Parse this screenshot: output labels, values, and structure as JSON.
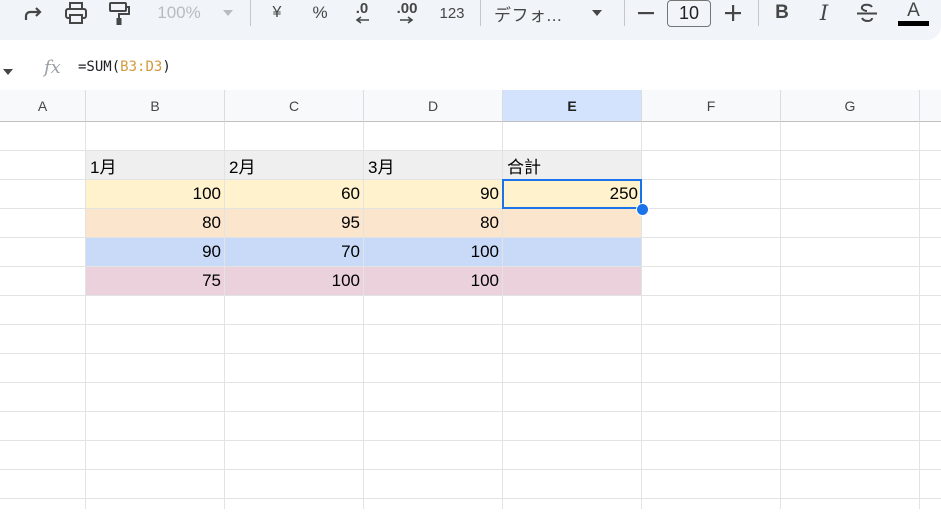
{
  "toolbar": {
    "zoom": "100%",
    "currency": "¥",
    "percent": "%",
    "decrease_decimal": ".0",
    "increase_decimal": ".00",
    "number_format": "123",
    "font_name": "デフォ...",
    "font_size": "10",
    "bold": "B",
    "italic": "I",
    "text_color_glyph": "A"
  },
  "formula_bar": {
    "fx": "fx",
    "prefix": "=SUM(",
    "ref": "B3:D3",
    "suffix": ")"
  },
  "columns": [
    "A",
    "B",
    "C",
    "D",
    "E",
    "F",
    "G"
  ],
  "selected_column": "E",
  "table": {
    "headers": [
      "1月",
      "2月",
      "3月",
      "合計"
    ],
    "rows": [
      {
        "values": [
          "100",
          "60",
          "90",
          "250"
        ],
        "color": "#fff2cc"
      },
      {
        "values": [
          "80",
          "95",
          "80",
          ""
        ],
        "color": "#fce5cd"
      },
      {
        "values": [
          "90",
          "70",
          "100",
          ""
        ],
        "color": "#c9daf8"
      },
      {
        "values": [
          "75",
          "100",
          "100",
          ""
        ],
        "color": "#ead1dc"
      }
    ],
    "header_color": "#efefef"
  },
  "colors": {
    "selection": "#1a73e8",
    "selected_header_bg": "#d3e3fd",
    "formula_ref": "#d49a3c"
  }
}
